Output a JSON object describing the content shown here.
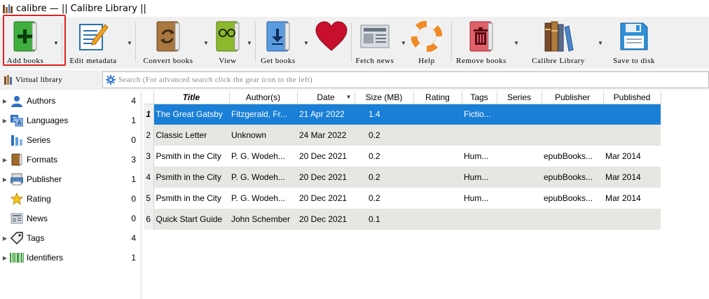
{
  "window": {
    "title": "calibre — || Calibre Library ||"
  },
  "toolbar": {
    "add_books": "Add books",
    "edit_metadata": "Edit metadata",
    "convert_books": "Convert books",
    "view": "View",
    "get_books": "Get books",
    "fetch_news": "Fetch news",
    "help": "Help",
    "remove_books": "Remove books",
    "calibre_library": "Calibre Library",
    "save_to_disk": "Save to disk"
  },
  "search": {
    "virtual_library": "Virtual library",
    "placeholder": "Search (For advanced search click the gear icon to the left)"
  },
  "sidebar": {
    "items": [
      {
        "label": "Authors",
        "count": "4",
        "icon": "person-icon"
      },
      {
        "label": "Languages",
        "count": "1",
        "icon": "languages-icon"
      },
      {
        "label": "Series",
        "count": "0",
        "icon": "series-icon"
      },
      {
        "label": "Formats",
        "count": "3",
        "icon": "book-icon"
      },
      {
        "label": "Publisher",
        "count": "1",
        "icon": "publisher-icon"
      },
      {
        "label": "Rating",
        "count": "0",
        "icon": "star-icon"
      },
      {
        "label": "News",
        "count": "0",
        "icon": "news-icon"
      },
      {
        "label": "Tags",
        "count": "4",
        "icon": "tag-icon"
      },
      {
        "label": "Identifiers",
        "count": "1",
        "icon": "barcode-icon"
      }
    ]
  },
  "table": {
    "columns": [
      "Title",
      "Author(s)",
      "Date",
      "Size (MB)",
      "Rating",
      "Tags",
      "Series",
      "Publisher",
      "Published"
    ],
    "rows": [
      {
        "n": "1",
        "title": "The Great Gatsby",
        "author": "Fitzgerald, Fr...",
        "date": "21 Apr 2022",
        "size": "1.4",
        "rating": "",
        "tags": "Fictio...",
        "series": "",
        "publisher": "",
        "published": ""
      },
      {
        "n": "2",
        "title": "Classic Letter",
        "author": "Unknown",
        "date": "24 Mar 2022",
        "size": "0.2",
        "rating": "",
        "tags": "",
        "series": "",
        "publisher": "",
        "published": ""
      },
      {
        "n": "3",
        "title": "Psmith in the City",
        "author": "P. G. Wodeh...",
        "date": "20 Dec 2021",
        "size": "0.2",
        "rating": "",
        "tags": "Hum...",
        "series": "",
        "publisher": "epubBooks...",
        "published": "Mar 2014"
      },
      {
        "n": "4",
        "title": "Psmith in the City",
        "author": "P. G. Wodeh...",
        "date": "20 Dec 2021",
        "size": "0.2",
        "rating": "",
        "tags": "Hum...",
        "series": "",
        "publisher": "epubBooks...",
        "published": "Mar 2014"
      },
      {
        "n": "5",
        "title": "Psmith in the City",
        "author": "P. G. Wodeh...",
        "date": "20 Dec 2021",
        "size": "0.2",
        "rating": "",
        "tags": "Hum...",
        "series": "",
        "publisher": "epubBooks...",
        "published": "Mar 2014"
      },
      {
        "n": "6",
        "title": "Quick Start Guide",
        "author": "John Schember",
        "date": "20 Dec 2021",
        "size": "0.1",
        "rating": "",
        "tags": "",
        "series": "",
        "publisher": "",
        "published": ""
      }
    ]
  },
  "colors": {
    "selection": "#1a7fd6",
    "highlight_box": "#e02020",
    "toolbar_bg": "#f0f0f0"
  }
}
